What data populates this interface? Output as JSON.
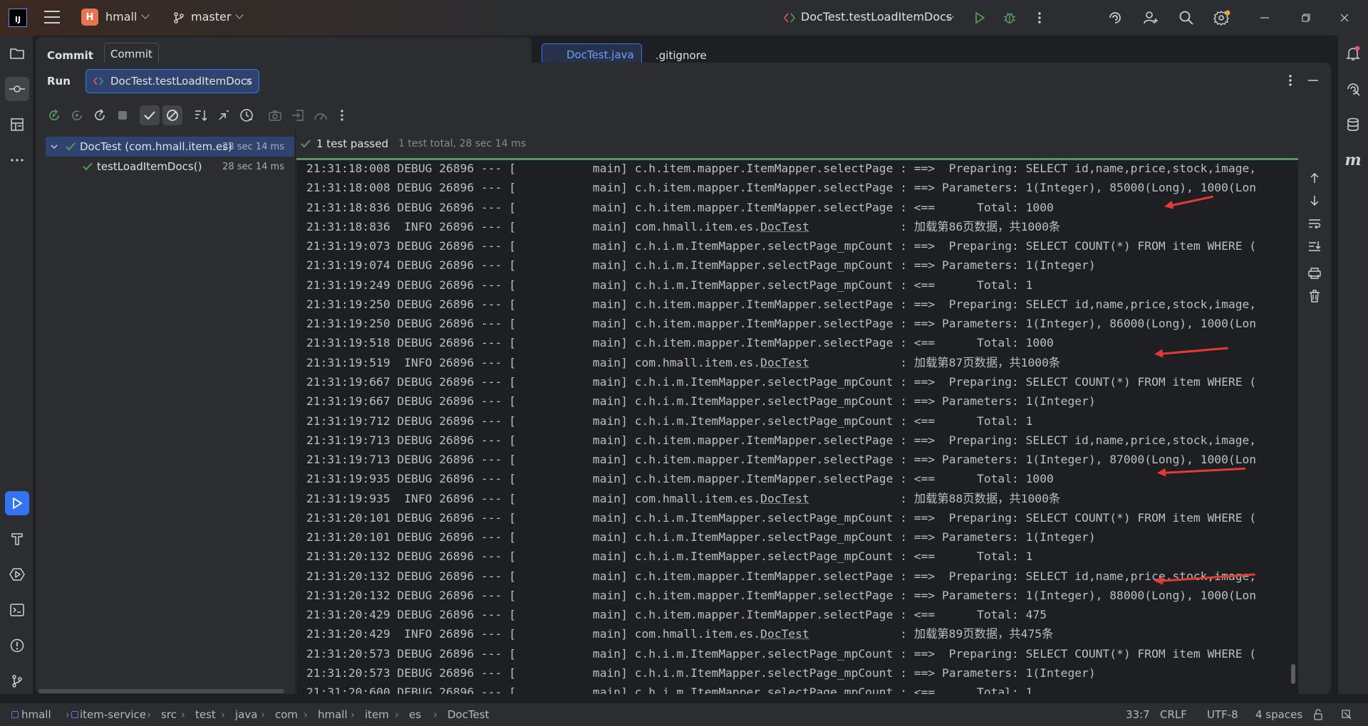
{
  "titlebar": {
    "logo_text": "IJ",
    "project_badge": "H",
    "project_name": "hmall",
    "branch": "master",
    "run_config": "DocTest.testLoadItemDocs"
  },
  "background_panels": {
    "commit_tab_1": "Commit",
    "commit_tab_2": "Commit",
    "editor_tab_1": "DocTest.java",
    "editor_tab_2": ".gitignore"
  },
  "run_window": {
    "title": "Run",
    "tab_label": "DocTest.testLoadItemDocs"
  },
  "tree": [
    {
      "label": "DocTest (com.hmall.item.es)",
      "time": "28 sec 14 ms"
    },
    {
      "label": "testLoadItemDocs()",
      "time": "28 sec 14 ms"
    }
  ],
  "test_status": {
    "passed": "1 test passed",
    "summary": "1 test total, 28 sec 14 ms"
  },
  "console_lines": [
    {
      "time": "21:31:18:008",
      "level": "DEBUG",
      "logger": "c.h.item.mapper.ItemMapper.selectPage",
      "msg": ": ==>  Preparing: SELECT id,name,price,stock,image,"
    },
    {
      "time": "21:31:18:008",
      "level": "DEBUG",
      "logger": "c.h.item.mapper.ItemMapper.selectPage",
      "msg": ": ==> Parameters: 1(Integer), 85000(Long), 1000(Lon"
    },
    {
      "time": "21:31:18:836",
      "level": "DEBUG",
      "logger": "c.h.item.mapper.ItemMapper.selectPage",
      "msg": ": <==      Total: 1000"
    },
    {
      "time": "21:31:18:836",
      "level": " INFO",
      "logger": "com.hmall.item.es.DocTest",
      "msg": ": 加载第86页数据，共1000条"
    },
    {
      "time": "21:31:19:073",
      "level": "DEBUG",
      "logger": "c.h.i.m.ItemMapper.selectPage_mpCount",
      "msg": ": ==>  Preparing: SELECT COUNT(*) FROM item WHERE ("
    },
    {
      "time": "21:31:19:074",
      "level": "DEBUG",
      "logger": "c.h.i.m.ItemMapper.selectPage_mpCount",
      "msg": ": ==> Parameters: 1(Integer)"
    },
    {
      "time": "21:31:19:249",
      "level": "DEBUG",
      "logger": "c.h.i.m.ItemMapper.selectPage_mpCount",
      "msg": ": <==      Total: 1"
    },
    {
      "time": "21:31:19:250",
      "level": "DEBUG",
      "logger": "c.h.item.mapper.ItemMapper.selectPage",
      "msg": ": ==>  Preparing: SELECT id,name,price,stock,image,"
    },
    {
      "time": "21:31:19:250",
      "level": "DEBUG",
      "logger": "c.h.item.mapper.ItemMapper.selectPage",
      "msg": ": ==> Parameters: 1(Integer), 86000(Long), 1000(Lon"
    },
    {
      "time": "21:31:19:518",
      "level": "DEBUG",
      "logger": "c.h.item.mapper.ItemMapper.selectPage",
      "msg": ": <==      Total: 1000"
    },
    {
      "time": "21:31:19:519",
      "level": " INFO",
      "logger": "com.hmall.item.es.DocTest",
      "msg": ": 加载第87页数据，共1000条"
    },
    {
      "time": "21:31:19:667",
      "level": "DEBUG",
      "logger": "c.h.i.m.ItemMapper.selectPage_mpCount",
      "msg": ": ==>  Preparing: SELECT COUNT(*) FROM item WHERE ("
    },
    {
      "time": "21:31:19:667",
      "level": "DEBUG",
      "logger": "c.h.i.m.ItemMapper.selectPage_mpCount",
      "msg": ": ==> Parameters: 1(Integer)"
    },
    {
      "time": "21:31:19:712",
      "level": "DEBUG",
      "logger": "c.h.i.m.ItemMapper.selectPage_mpCount",
      "msg": ": <==      Total: 1"
    },
    {
      "time": "21:31:19:713",
      "level": "DEBUG",
      "logger": "c.h.item.mapper.ItemMapper.selectPage",
      "msg": ": ==>  Preparing: SELECT id,name,price,stock,image,"
    },
    {
      "time": "21:31:19:713",
      "level": "DEBUG",
      "logger": "c.h.item.mapper.ItemMapper.selectPage",
      "msg": ": ==> Parameters: 1(Integer), 87000(Long), 1000(Lon"
    },
    {
      "time": "21:31:19:935",
      "level": "DEBUG",
      "logger": "c.h.item.mapper.ItemMapper.selectPage",
      "msg": ": <==      Total: 1000"
    },
    {
      "time": "21:31:19:935",
      "level": " INFO",
      "logger": "com.hmall.item.es.DocTest",
      "msg": ": 加载第88页数据，共1000条"
    },
    {
      "time": "21:31:20:101",
      "level": "DEBUG",
      "logger": "c.h.i.m.ItemMapper.selectPage_mpCount",
      "msg": ": ==>  Preparing: SELECT COUNT(*) FROM item WHERE ("
    },
    {
      "time": "21:31:20:101",
      "level": "DEBUG",
      "logger": "c.h.i.m.ItemMapper.selectPage_mpCount",
      "msg": ": ==> Parameters: 1(Integer)"
    },
    {
      "time": "21:31:20:132",
      "level": "DEBUG",
      "logger": "c.h.i.m.ItemMapper.selectPage_mpCount",
      "msg": ": <==      Total: 1"
    },
    {
      "time": "21:31:20:132",
      "level": "DEBUG",
      "logger": "c.h.item.mapper.ItemMapper.selectPage",
      "msg": ": ==>  Preparing: SELECT id,name,price,stock,image,"
    },
    {
      "time": "21:31:20:132",
      "level": "DEBUG",
      "logger": "c.h.item.mapper.ItemMapper.selectPage",
      "msg": ": ==> Parameters: 1(Integer), 88000(Long), 1000(Lon"
    },
    {
      "time": "21:31:20:429",
      "level": "DEBUG",
      "logger": "c.h.item.mapper.ItemMapper.selectPage",
      "msg": ": <==      Total: 475"
    },
    {
      "time": "21:31:20:429",
      "level": " INFO",
      "logger": "com.hmall.item.es.DocTest",
      "msg": ": 加载第89页数据，共475条"
    },
    {
      "time": "21:31:20:573",
      "level": "DEBUG",
      "logger": "c.h.i.m.ItemMapper.selectPage_mpCount",
      "msg": ": ==>  Preparing: SELECT COUNT(*) FROM item WHERE ("
    },
    {
      "time": "21:31:20:573",
      "level": "DEBUG",
      "logger": "c.h.i.m.ItemMapper.selectPage_mpCount",
      "msg": ": ==> Parameters: 1(Integer)"
    },
    {
      "time": "21:31:20:600",
      "level": "DEBUG",
      "logger": "c.h.i.m.ItemMapper.selectPage_mpCount",
      "msg": ": <==      Total: 1"
    }
  ],
  "console_common": {
    "pid": "26896",
    "sep": "--- [",
    "thread": "main]"
  },
  "breadcrumbs": [
    "hmall",
    "item-service",
    "src",
    "test",
    "java",
    "com",
    "hmall",
    "item",
    "es",
    "DocTest"
  ],
  "statusbar": {
    "position": "33:7",
    "line_sep": "CRLF",
    "encoding": "UTF-8",
    "indent": "4 spaces"
  },
  "colors": {
    "accent": "#3574f0",
    "pass": "#57965c",
    "annotation_arrow": "#e53935"
  }
}
